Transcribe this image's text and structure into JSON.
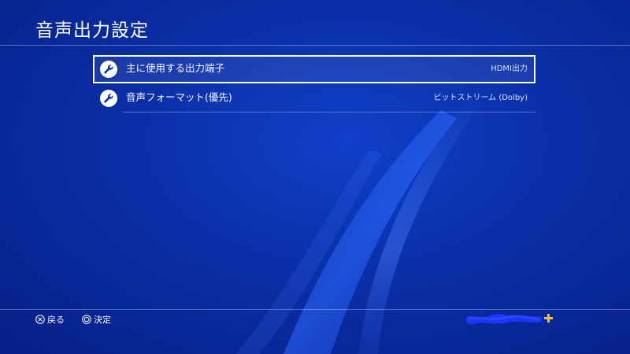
{
  "header": {
    "title": "音声出力設定"
  },
  "menu": {
    "items": [
      {
        "label": "主に使用する出力端子",
        "value": "HDMI出力",
        "icon": "wrench-icon",
        "selected": true
      },
      {
        "label": "音声フォーマット(優先)",
        "value": "ビットストリーム (Dolby)",
        "icon": "wrench-icon",
        "selected": false
      }
    ]
  },
  "footer": {
    "back_label": "戻る",
    "back_button_icon": "cross-button-icon",
    "enter_label": "決定",
    "enter_button_icon": "circle-button-icon",
    "psplus_icon": "ps-plus-icon"
  },
  "colors": {
    "background": "#0a2fa6",
    "text": "#ffffff",
    "redaction": "#1a35ff",
    "psplus": "#f5c21a"
  }
}
